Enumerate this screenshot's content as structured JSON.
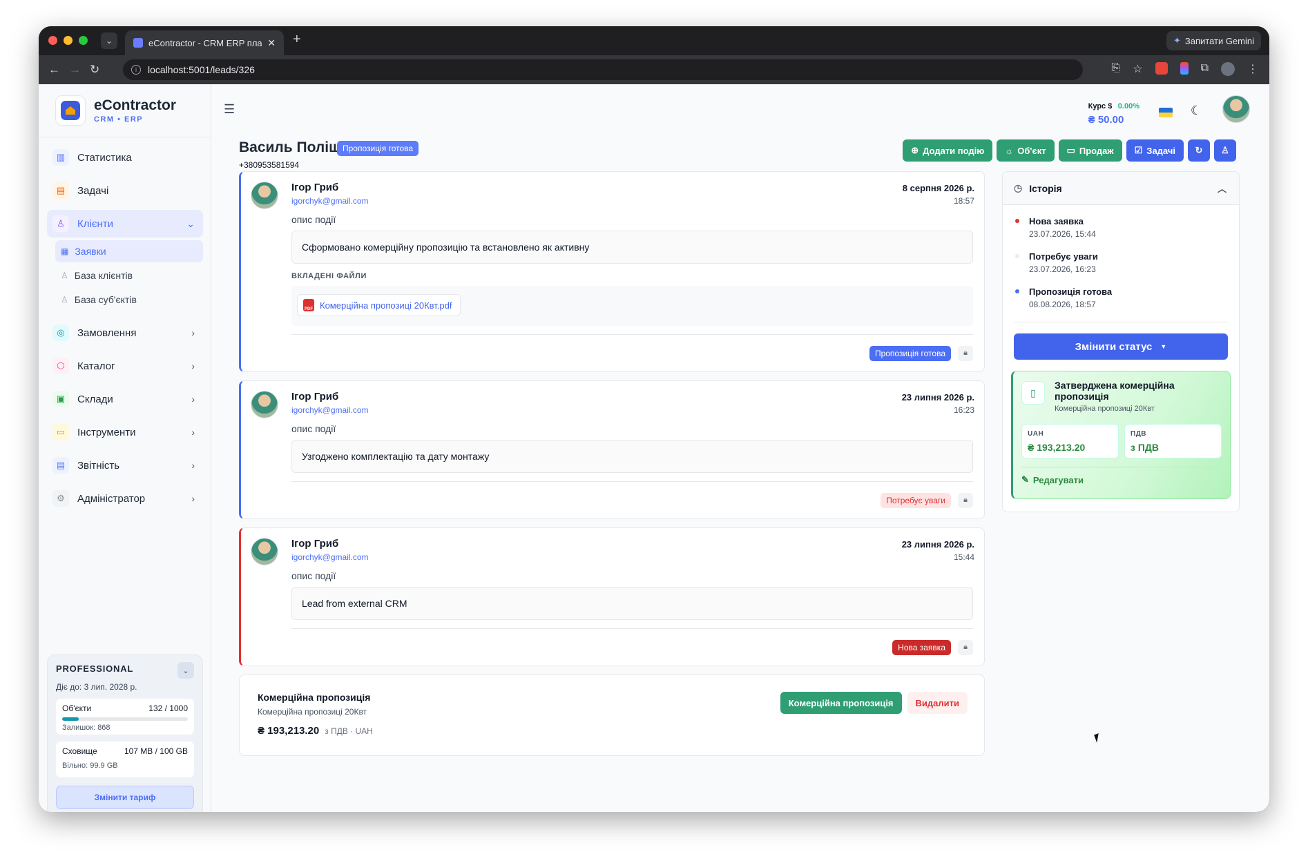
{
  "browser": {
    "tab_title": "eContractor - CRM ERP платф",
    "url": "localhost:5001/leads/326",
    "gemini_label": "Запитати Gemini"
  },
  "sidebar": {
    "brand": "eContractor",
    "brand_sub": "CRM • ERP",
    "items": [
      {
        "label": "Статистика",
        "icon": "chart-icon",
        "color": "#4c6ef5"
      },
      {
        "label": "Задачі",
        "icon": "clipboard-icon",
        "color": "#f76707"
      },
      {
        "label": "Клієнти",
        "icon": "users-icon",
        "color": "#7950f2"
      },
      {
        "label": "Замовлення",
        "icon": "orders-icon",
        "color": "#1098ad"
      },
      {
        "label": "Каталог",
        "icon": "box-icon",
        "color": "#e64980"
      },
      {
        "label": "Склади",
        "icon": "warehouse-icon",
        "color": "#2f9e44"
      },
      {
        "label": "Інструменти",
        "icon": "toolbox-icon",
        "color": "#f08c00"
      },
      {
        "label": "Звітність",
        "icon": "report-icon",
        "color": "#5c7cfa"
      },
      {
        "label": "Адміністратор",
        "icon": "gear-icon",
        "color": "#868e96"
      }
    ],
    "sub_items": [
      "Заявки",
      "База клієнтів",
      "База суб'єктів"
    ],
    "plan": {
      "name": "PROFESSIONAL",
      "valid": "Діє до: 3 лип. 2028 р.",
      "objects_label": "Об'єкти",
      "objects_value": "132 / 1000",
      "objects_fraction": 0.132,
      "objects_remaining": "Залишок: 868",
      "storage_label": "Сховище",
      "storage_value": "107 MB / 100 GB",
      "storage_fraction": 0.001,
      "storage_free": "Вільно: 99.9 GB",
      "change_button": "Змінити тариф"
    }
  },
  "topbar": {
    "rate_label": "Курс $",
    "rate_change": "0.00%",
    "rate_value": "₴ 50.00"
  },
  "lead": {
    "name": "Василь Поліщук",
    "status": "Пропозиція готова",
    "phone": "+380953581594"
  },
  "actions": {
    "add_event": "Додати подію",
    "object": "Об'єкт",
    "sale": "Продаж",
    "tasks": "Задачі"
  },
  "events": [
    {
      "author": "Ігор Гриб",
      "email": "igorchyk@gmail.com",
      "date": "8 серпня 2026 р.",
      "time": "18:57",
      "label": "опис події",
      "description": "Сформовано комерційну пропозицію та встановлено як активну",
      "files_label": "ВКЛАДЕНІ ФАЙЛИ",
      "file_name": "Комерційна пропозиці 20Квт.pdf",
      "file_type": "PDF",
      "status": "Пропозиція готова"
    },
    {
      "author": "Ігор Гриб",
      "email": "igorchyk@gmail.com",
      "date": "23 липня 2026 р.",
      "time": "16:23",
      "label": "опис події",
      "description": "Узгоджено комплектацію та дату монтажу",
      "status": "Потребує уваги"
    },
    {
      "author": "Ігор Гриб",
      "email": "igorchyk@gmail.com",
      "date": "23 липня 2026 р.",
      "time": "15:44",
      "label": "опис події",
      "description": "Lead from external CRM",
      "status": "Нова заявка"
    }
  ],
  "proposal": {
    "title": "Комерційна пропозиція",
    "subtitle": "Комерційна пропозиці 20Квт",
    "sum": "₴ 193,213.20",
    "meta": "з ПДВ · UAH",
    "open_button": "Комерційна пропозиція",
    "delete_button": "Видалити"
  },
  "history": {
    "title": "Історія",
    "items": [
      {
        "title": "Нова заявка",
        "date": "23.07.2026, 15:44",
        "color": "#e03131"
      },
      {
        "title": "Потребує уваги",
        "date": "23.07.2026, 16:23",
        "color": "#e9ecef"
      },
      {
        "title": "Пропозиція готова",
        "date": "08.08.2026, 18:57",
        "color": "#4c6ef5"
      }
    ],
    "change_status": "Змінити статус",
    "approved": {
      "title": "Затверджена комерційна пропозиція",
      "subtitle": "Комерційна пропозиці 20Квт",
      "uah_label": "UAH",
      "uah_value": "₴ 193,213.20",
      "vat_label": "ПДВ",
      "vat_value": "з ПДВ",
      "edit": "Редагувати"
    }
  }
}
